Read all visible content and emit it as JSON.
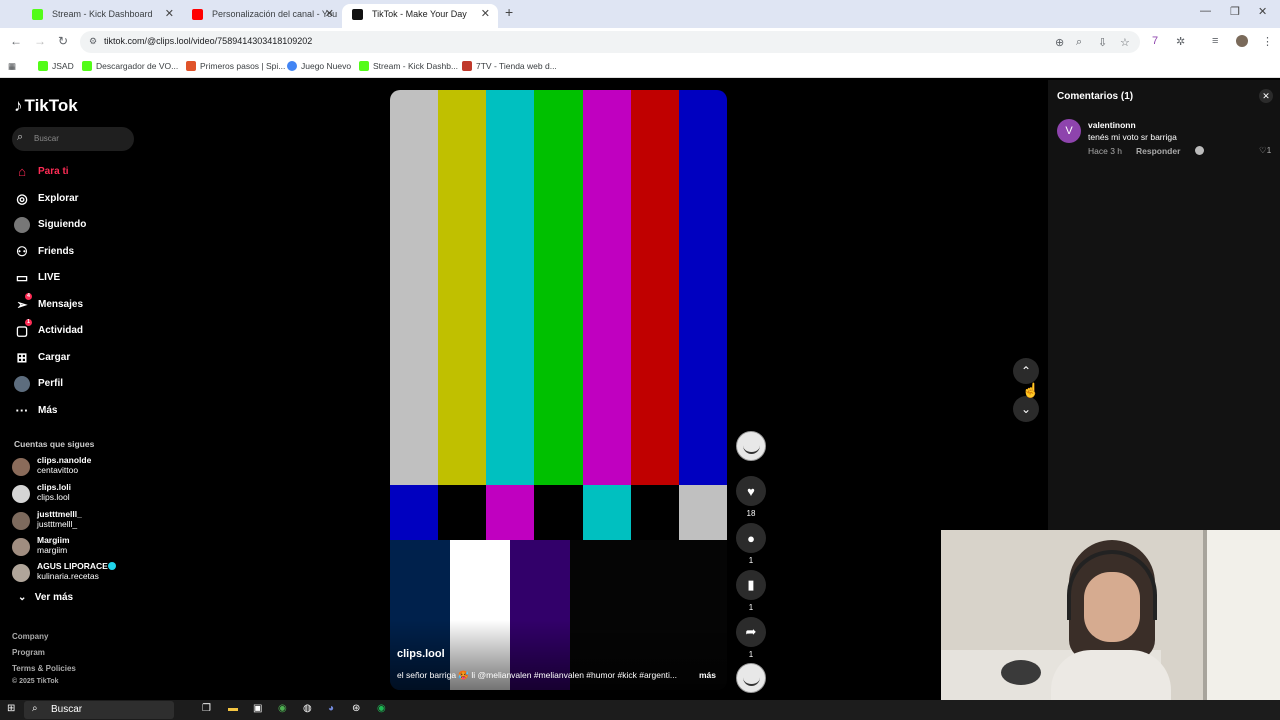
{
  "browser": {
    "tabs": [
      {
        "title": "Stream - Kick Dashboard",
        "color": "#53fc18"
      },
      {
        "title": "Personalización del canal - You",
        "color": "#ff0000"
      },
      {
        "title": "TikTok - Make Your Day",
        "color": "#111111"
      }
    ],
    "url": "tiktok.com/@clips.lool/video/7589414303418109202",
    "bookmarks": [
      {
        "label": "JSAD",
        "color": "#53fc18"
      },
      {
        "label": "Descargador de VO...",
        "color": "#53fc18"
      },
      {
        "label": "Primeros pasos | Spi...",
        "color": "#e0532a"
      },
      {
        "label": "Juego Nuevo",
        "color": "#4285f4"
      },
      {
        "label": "Stream - Kick Dashb...",
        "color": "#53fc18"
      },
      {
        "label": "7TV - Tienda web d...",
        "color": "#c0392b"
      }
    ]
  },
  "sidebar": {
    "logo": "TikTok",
    "search_placeholder": "Buscar",
    "nav": [
      {
        "label": "Para ti",
        "icon": "home-icon",
        "glyph": "⌂",
        "active": true
      },
      {
        "label": "Explorar",
        "icon": "compass-icon",
        "glyph": "◎"
      },
      {
        "label": "Siguiendo",
        "icon": "following-icon",
        "glyph": "●"
      },
      {
        "label": "Friends",
        "icon": "friends-icon",
        "glyph": "⚇"
      },
      {
        "label": "LIVE",
        "icon": "live-icon",
        "glyph": "▭"
      },
      {
        "label": "Mensajes",
        "icon": "messages-icon",
        "glyph": "➢",
        "badge": "4"
      },
      {
        "label": "Actividad",
        "icon": "activity-icon",
        "glyph": "▢",
        "badge": "1"
      },
      {
        "label": "Cargar",
        "icon": "upload-icon",
        "glyph": "⊞"
      },
      {
        "label": "Perfil",
        "icon": "profile-icon",
        "glyph": "●"
      },
      {
        "label": "Más",
        "icon": "more-icon",
        "glyph": "···"
      }
    ],
    "following_header": "Cuentas que sigues",
    "following": [
      {
        "handle": "clips.nanolde",
        "name": "centavittoo"
      },
      {
        "handle": "clips.loli",
        "name": "clips.lool"
      },
      {
        "handle": "justttmelll_",
        "name": "justttmelll_"
      },
      {
        "handle": "Margiim",
        "name": "margiim"
      },
      {
        "handle": "AGUS LIPORACE",
        "name": "kulinaria.recetas"
      }
    ],
    "see_more": "Ver más",
    "footer": [
      "Company",
      "Program",
      "Terms & Policies",
      "© 2025 TikTok"
    ]
  },
  "video": {
    "author": "clips.lool",
    "caption": "el señor barriga 🥵 li @melianvalen #melianvalen #humor #kick #argenti...",
    "more": "más"
  },
  "actions": {
    "likes": "18",
    "comments": "1",
    "saves": "1",
    "shares": "1"
  },
  "comments": {
    "title": "Comentarios (1)",
    "items": [
      {
        "avatar_letter": "V",
        "user": "valentinonn",
        "text": "tenés mi voto sr barriga",
        "time": "Hace 3 h",
        "reply": "Responder",
        "likes": "1"
      }
    ]
  },
  "taskbar": {
    "search_label": "Buscar"
  }
}
